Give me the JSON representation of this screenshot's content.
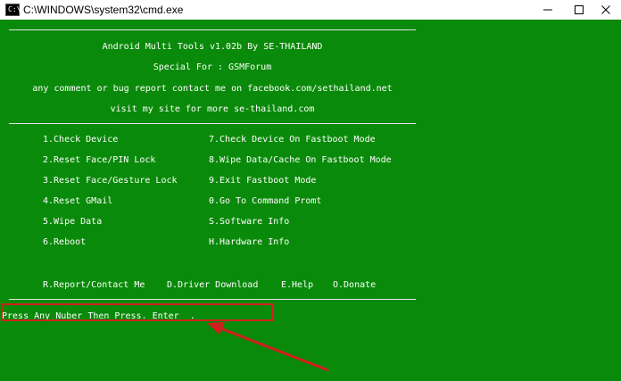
{
  "window": {
    "title": "C:\\WINDOWS\\system32\\cmd.exe",
    "icon": "cmd-icon",
    "icon_text": "C:\\",
    "controls": {
      "minimize": "minimize-icon",
      "maximize": "maximize-icon",
      "close": "close-icon"
    }
  },
  "header": {
    "line1": "Android Multi Tools v1.02b By SE-THAILAND",
    "line2": "Special For : GSMForum",
    "line3": "any comment or bug report contact me on facebook.com/sethailand.net",
    "line4": "visit my site for more se-thailand.com"
  },
  "menu": {
    "left": [
      "1.Check Device",
      "2.Reset Face/PIN Lock",
      "3.Reset Face/Gesture Lock",
      "4.Reset GMail",
      "5.Wipe Data",
      "6.Reboot"
    ],
    "right": [
      "7.Check Device On Fastboot Mode",
      "8.Wipe Data/Cache On Fastboot Mode",
      "9.Exit Fastboot Mode",
      "0.Go To Command Promt",
      "S.Software Info",
      "H.Hardware Info"
    ],
    "bottom": [
      "R.Report/Contact Me",
      "D.Driver Download",
      "E.Help",
      "O.Donate"
    ]
  },
  "prompt": "Press Any Nuber Then Press. Enter  .",
  "colors": {
    "console_bg": "#0a8a0a",
    "console_text": "#ffffff",
    "annotation": "#d21f1f"
  }
}
